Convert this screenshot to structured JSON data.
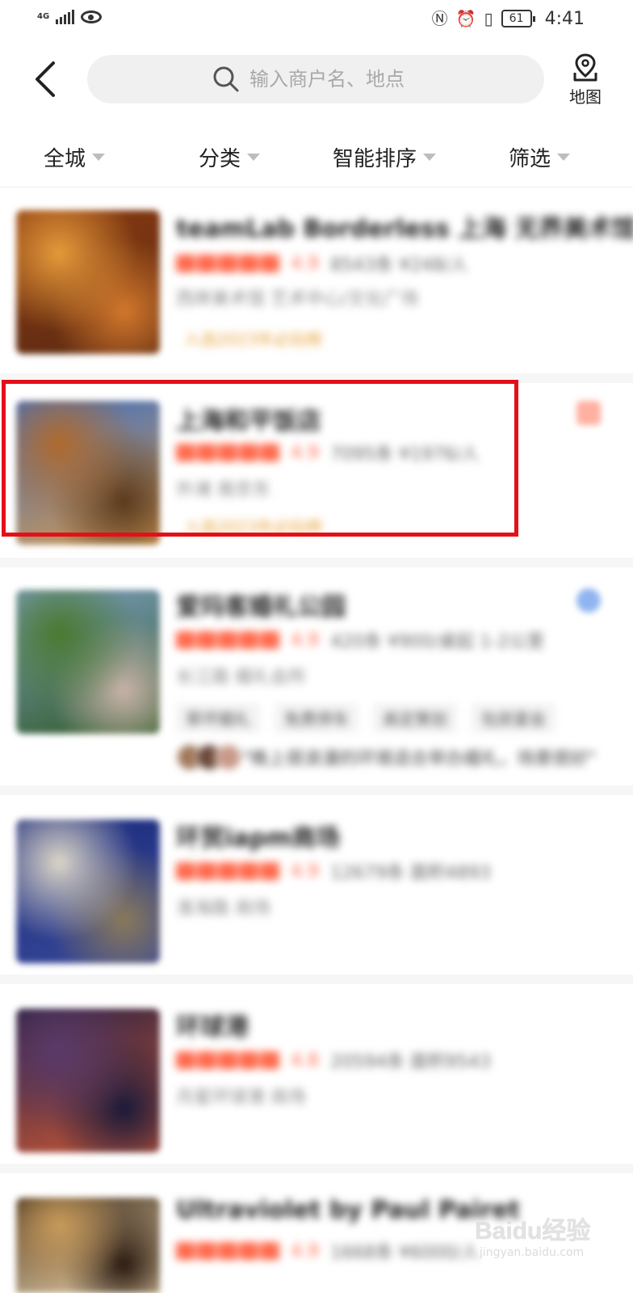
{
  "status_bar": {
    "network": "4G",
    "battery": "61",
    "time": "4:41"
  },
  "search": {
    "placeholder": "输入商户名、地点",
    "map_label": "地图"
  },
  "filters": [
    {
      "label": "全城"
    },
    {
      "label": "分类"
    },
    {
      "label": "智能排序"
    },
    {
      "label": "筛选"
    }
  ],
  "listings": [
    {
      "title": "teamLab Borderless 上海 无界美术馆",
      "score": "4.9",
      "meta": "8543条 ¥248/人",
      "subline": "西岸美术馆  艺术中心/文化广场",
      "promo": "入选2023年必玩榜",
      "colors": [
        "#8a3a10",
        "#e59a3a",
        "#5a2a12",
        "#d2782c"
      ]
    },
    {
      "title": "上海和平饭店",
      "score": "4.9",
      "meta": "7095条 ¥1976/人",
      "subline": "外滩  南京东",
      "promo": "入选2023年必玩榜",
      "colors": [
        "#3a6fc8",
        "#b06a2c",
        "#d99a48",
        "#5b3a1c"
      ]
    },
    {
      "title": "爱玛客婚礼公园",
      "score": "4.9",
      "meta": "420条 ¥900/桌起  1-2公里",
      "subline": "长江路  婚礼会所",
      "tags": [
        "草坪婚礼",
        "免费停车",
        "高定策划",
        "包房宴会"
      ],
      "review": "\"晚上很浪漫的环境适合举办婚礼，场景很好\"",
      "colors": [
        "#7fa0c8",
        "#4a7a30",
        "#2e5a22",
        "#c8b2a8"
      ]
    },
    {
      "title": "环贸iapm商场",
      "score": "4.9",
      "meta": "12679条 面积4893",
      "subline": "淮海路  商场",
      "colors": [
        "#1a2a7a",
        "#dcd6c8",
        "#3a4a9a",
        "#8a7a5a"
      ]
    },
    {
      "title": "环球港",
      "score": "4.8",
      "meta": "20594条 面积9543",
      "subline": "月星环球港  商场",
      "colors": [
        "#2a2040",
        "#5a3a6a",
        "#c8583a",
        "#1a1a3a"
      ]
    },
    {
      "title": "Ultraviolet by Paul Pairet",
      "score": "4.9",
      "meta": "1668条 ¥6000/人",
      "subline": "外滩  西餐",
      "colors": [
        "#3a2a1a",
        "#c89a5a",
        "#f0d8b0",
        "#2a1a10"
      ]
    }
  ],
  "watermark": {
    "logo": "Baidu经验",
    "url": "jingyan.baidu.com"
  },
  "colors": {
    "accent_orange": "#ff6a4d",
    "highlight_red": "#e3101a",
    "promo_gold": "#e8a23a"
  }
}
